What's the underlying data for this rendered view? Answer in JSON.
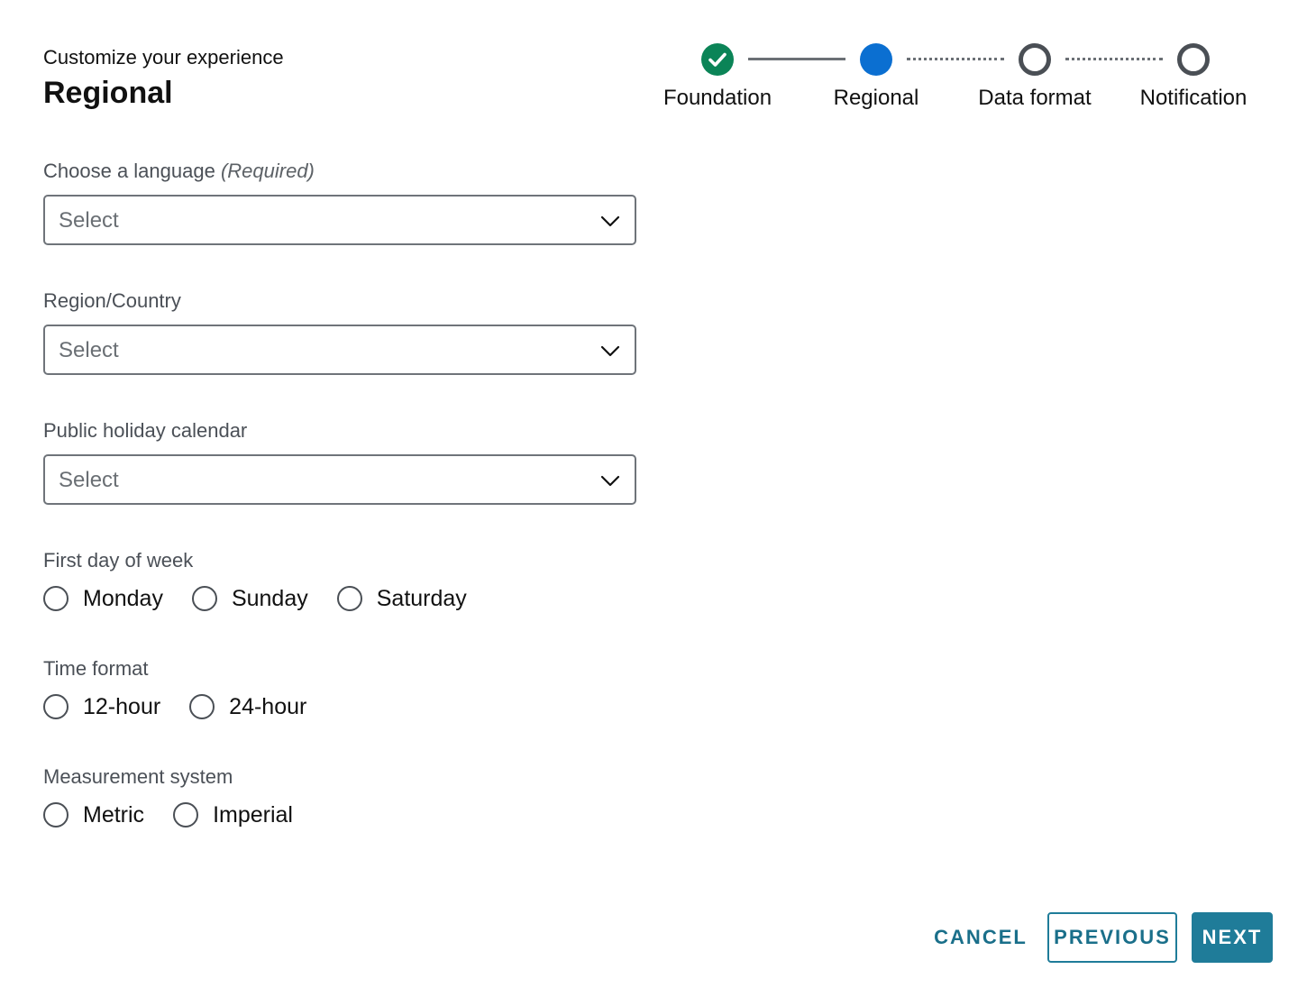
{
  "header": {
    "subtitle": "Customize your experience",
    "title": "Regional"
  },
  "stepper": {
    "steps": [
      {
        "label": "Foundation",
        "status": "complete",
        "icon": "check-icon"
      },
      {
        "label": "Regional",
        "status": "current"
      },
      {
        "label": "Data format",
        "status": "upcoming"
      },
      {
        "label": "Notification",
        "status": "upcoming"
      }
    ],
    "colors": {
      "complete": "#0b8457",
      "current": "#0b6fd1",
      "upcoming": "#4a4f55"
    }
  },
  "form": {
    "language": {
      "label": "Choose a language",
      "required_text": "(Required)",
      "value": "Select",
      "icon": "chevron-down-icon"
    },
    "region": {
      "label": "Region/Country",
      "value": "Select",
      "icon": "chevron-down-icon"
    },
    "holiday_calendar": {
      "label": "Public holiday calendar",
      "value": "Select",
      "icon": "chevron-down-icon"
    },
    "first_day": {
      "label": "First day of week",
      "options": [
        "Monday",
        "Sunday",
        "Saturday"
      ],
      "selected": null
    },
    "time_format": {
      "label": "Time format",
      "options": [
        "12-hour",
        "24-hour"
      ],
      "selected": null
    },
    "measurement": {
      "label": "Measurement system",
      "options": [
        "Metric",
        "Imperial"
      ],
      "selected": null
    }
  },
  "footer": {
    "cancel_label": "CANCEL",
    "previous_label": "PREVIOUS",
    "next_label": "NEXT",
    "accent_color": "#1f7c99"
  }
}
